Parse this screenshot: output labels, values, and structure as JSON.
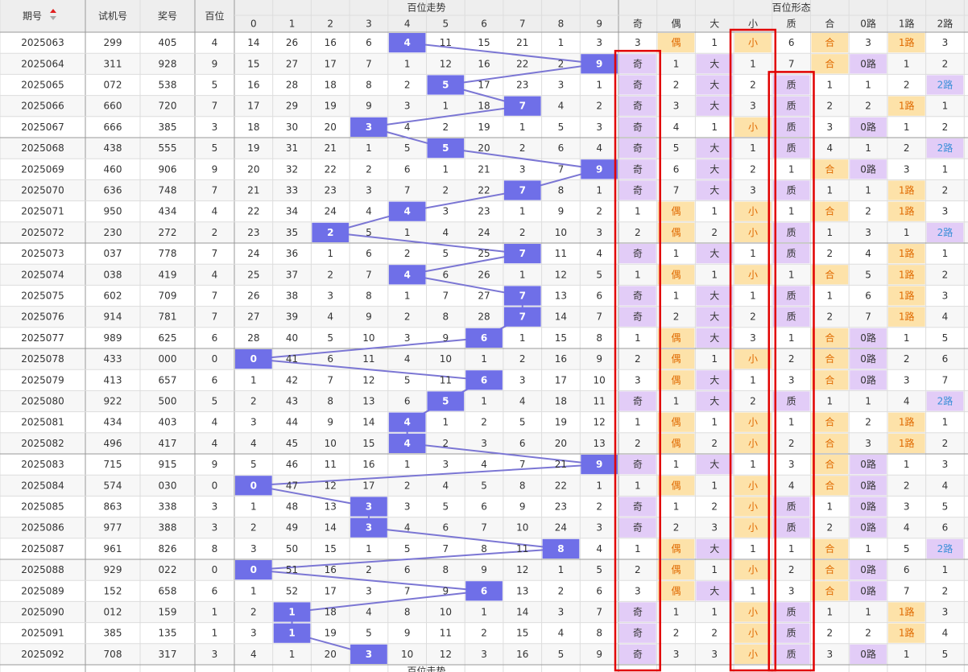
{
  "header": {
    "period_label": "期号",
    "test_label": "试机号",
    "prize_label": "奖号",
    "hundreds_label": "百位",
    "trend_label": "百位走势",
    "form_label": "百位形态",
    "trend_digits": [
      "0",
      "1",
      "2",
      "3",
      "4",
      "5",
      "6",
      "7",
      "8",
      "9"
    ],
    "form_labels": [
      "奇",
      "偶",
      "大",
      "小",
      "质",
      "合",
      "0路",
      "1路",
      "2路"
    ],
    "bottom_partial_label": "百位走势"
  },
  "colors": {
    "header_bg": "#eeeeee",
    "border": "#dddddd",
    "group_border": "#999999",
    "alt_row": "#f7f7f7",
    "blue_ball": "#6f6fe8",
    "line": "#7b76d4",
    "odd_purple": "#e2ccf7",
    "even_orange": "#fde2a9",
    "even_text": "#e06a00",
    "highlight_red": "#e10000"
  },
  "markers": {
    "odd": "奇",
    "even": "偶",
    "big": "大",
    "small": "小",
    "prime": "质",
    "composite": "合",
    "r0": "0路",
    "r1": "1路",
    "r2": "2路"
  },
  "rows": [
    {
      "issue": "2025063",
      "test": "299",
      "prize": "405",
      "h": "4",
      "t": [
        "14",
        "26",
        "16",
        "6",
        "4",
        "11",
        "15",
        "21",
        "1",
        "3"
      ],
      "f": [
        "3",
        "偶",
        "1",
        "小",
        "6",
        "合",
        "3",
        "1路",
        "3"
      ]
    },
    {
      "issue": "2025064",
      "test": "311",
      "prize": "928",
      "h": "9",
      "t": [
        "15",
        "27",
        "17",
        "7",
        "1",
        "12",
        "16",
        "22",
        "2",
        "9"
      ],
      "f": [
        "奇",
        "1",
        "大",
        "1",
        "7",
        "合",
        "0路",
        "1",
        "2"
      ]
    },
    {
      "issue": "2025065",
      "test": "072",
      "prize": "538",
      "h": "5",
      "t": [
        "16",
        "28",
        "18",
        "8",
        "2",
        "5",
        "17",
        "23",
        "3",
        "1"
      ],
      "f": [
        "奇",
        "2",
        "大",
        "2",
        "质",
        "1",
        "1",
        "2",
        "2路"
      ]
    },
    {
      "issue": "2025066",
      "test": "660",
      "prize": "720",
      "h": "7",
      "t": [
        "17",
        "29",
        "19",
        "9",
        "3",
        "1",
        "18",
        "7",
        "4",
        "2"
      ],
      "f": [
        "奇",
        "3",
        "大",
        "3",
        "质",
        "2",
        "2",
        "1路",
        "1"
      ]
    },
    {
      "issue": "2025067",
      "test": "666",
      "prize": "385",
      "h": "3",
      "t": [
        "18",
        "30",
        "20",
        "3",
        "4",
        "2",
        "19",
        "1",
        "5",
        "3"
      ],
      "f": [
        "奇",
        "4",
        "1",
        "小",
        "质",
        "3",
        "0路",
        "1",
        "2"
      ]
    },
    {
      "issue": "2025068",
      "test": "438",
      "prize": "555",
      "h": "5",
      "t": [
        "19",
        "31",
        "21",
        "1",
        "5",
        "5",
        "20",
        "2",
        "6",
        "4"
      ],
      "f": [
        "奇",
        "5",
        "大",
        "1",
        "质",
        "4",
        "1",
        "2",
        "2路"
      ]
    },
    {
      "issue": "2025069",
      "test": "460",
      "prize": "906",
      "h": "9",
      "t": [
        "20",
        "32",
        "22",
        "2",
        "6",
        "1",
        "21",
        "3",
        "7",
        "9"
      ],
      "f": [
        "奇",
        "6",
        "大",
        "2",
        "1",
        "合",
        "0路",
        "3",
        "1"
      ]
    },
    {
      "issue": "2025070",
      "test": "636",
      "prize": "748",
      "h": "7",
      "t": [
        "21",
        "33",
        "23",
        "3",
        "7",
        "2",
        "22",
        "7",
        "8",
        "1"
      ],
      "f": [
        "奇",
        "7",
        "大",
        "3",
        "质",
        "1",
        "1",
        "1路",
        "2"
      ]
    },
    {
      "issue": "2025071",
      "test": "950",
      "prize": "434",
      "h": "4",
      "t": [
        "22",
        "34",
        "24",
        "4",
        "4",
        "3",
        "23",
        "1",
        "9",
        "2"
      ],
      "f": [
        "1",
        "偶",
        "1",
        "小",
        "1",
        "合",
        "2",
        "1路",
        "3"
      ]
    },
    {
      "issue": "2025072",
      "test": "230",
      "prize": "272",
      "h": "2",
      "t": [
        "23",
        "35",
        "2",
        "5",
        "1",
        "4",
        "24",
        "2",
        "10",
        "3"
      ],
      "f": [
        "2",
        "偶",
        "2",
        "小",
        "质",
        "1",
        "3",
        "1",
        "2路"
      ]
    },
    {
      "issue": "2025073",
      "test": "037",
      "prize": "778",
      "h": "7",
      "t": [
        "24",
        "36",
        "1",
        "6",
        "2",
        "5",
        "25",
        "7",
        "11",
        "4"
      ],
      "f": [
        "奇",
        "1",
        "大",
        "1",
        "质",
        "2",
        "4",
        "1路",
        "1"
      ]
    },
    {
      "issue": "2025074",
      "test": "038",
      "prize": "419",
      "h": "4",
      "t": [
        "25",
        "37",
        "2",
        "7",
        "4",
        "6",
        "26",
        "1",
        "12",
        "5"
      ],
      "f": [
        "1",
        "偶",
        "1",
        "小",
        "1",
        "合",
        "5",
        "1路",
        "2"
      ]
    },
    {
      "issue": "2025075",
      "test": "602",
      "prize": "709",
      "h": "7",
      "t": [
        "26",
        "38",
        "3",
        "8",
        "1",
        "7",
        "27",
        "7",
        "13",
        "6"
      ],
      "f": [
        "奇",
        "1",
        "大",
        "1",
        "质",
        "1",
        "6",
        "1路",
        "3"
      ]
    },
    {
      "issue": "2025076",
      "test": "914",
      "prize": "781",
      "h": "7",
      "t": [
        "27",
        "39",
        "4",
        "9",
        "2",
        "8",
        "28",
        "7",
        "14",
        "7"
      ],
      "f": [
        "奇",
        "2",
        "大",
        "2",
        "质",
        "2",
        "7",
        "1路",
        "4"
      ]
    },
    {
      "issue": "2025077",
      "test": "989",
      "prize": "625",
      "h": "6",
      "t": [
        "28",
        "40",
        "5",
        "10",
        "3",
        "9",
        "6",
        "1",
        "15",
        "8"
      ],
      "f": [
        "1",
        "偶",
        "大",
        "3",
        "1",
        "合",
        "0路",
        "1",
        "5"
      ]
    },
    {
      "issue": "2025078",
      "test": "433",
      "prize": "000",
      "h": "0",
      "t": [
        "0",
        "41",
        "6",
        "11",
        "4",
        "10",
        "1",
        "2",
        "16",
        "9"
      ],
      "f": [
        "2",
        "偶",
        "1",
        "小",
        "2",
        "合",
        "0路",
        "2",
        "6"
      ]
    },
    {
      "issue": "2025079",
      "test": "413",
      "prize": "657",
      "h": "6",
      "t": [
        "1",
        "42",
        "7",
        "12",
        "5",
        "11",
        "6",
        "3",
        "17",
        "10"
      ],
      "f": [
        "3",
        "偶",
        "大",
        "1",
        "3",
        "合",
        "0路",
        "3",
        "7"
      ]
    },
    {
      "issue": "2025080",
      "test": "922",
      "prize": "500",
      "h": "5",
      "t": [
        "2",
        "43",
        "8",
        "13",
        "6",
        "5",
        "1",
        "4",
        "18",
        "11"
      ],
      "f": [
        "奇",
        "1",
        "大",
        "2",
        "质",
        "1",
        "1",
        "4",
        "2路"
      ]
    },
    {
      "issue": "2025081",
      "test": "434",
      "prize": "403",
      "h": "4",
      "t": [
        "3",
        "44",
        "9",
        "14",
        "4",
        "1",
        "2",
        "5",
        "19",
        "12"
      ],
      "f": [
        "1",
        "偶",
        "1",
        "小",
        "1",
        "合",
        "2",
        "1路",
        "1"
      ]
    },
    {
      "issue": "2025082",
      "test": "496",
      "prize": "417",
      "h": "4",
      "t": [
        "4",
        "45",
        "10",
        "15",
        "4",
        "2",
        "3",
        "6",
        "20",
        "13"
      ],
      "f": [
        "2",
        "偶",
        "2",
        "小",
        "2",
        "合",
        "3",
        "1路",
        "2"
      ]
    },
    {
      "issue": "2025083",
      "test": "715",
      "prize": "915",
      "h": "9",
      "t": [
        "5",
        "46",
        "11",
        "16",
        "1",
        "3",
        "4",
        "7",
        "21",
        "9"
      ],
      "f": [
        "奇",
        "1",
        "大",
        "1",
        "3",
        "合",
        "0路",
        "1",
        "3"
      ]
    },
    {
      "issue": "2025084",
      "test": "574",
      "prize": "030",
      "h": "0",
      "t": [
        "0",
        "47",
        "12",
        "17",
        "2",
        "4",
        "5",
        "8",
        "22",
        "1"
      ],
      "f": [
        "1",
        "偶",
        "1",
        "小",
        "4",
        "合",
        "0路",
        "2",
        "4"
      ]
    },
    {
      "issue": "2025085",
      "test": "863",
      "prize": "338",
      "h": "3",
      "t": [
        "1",
        "48",
        "13",
        "3",
        "3",
        "5",
        "6",
        "9",
        "23",
        "2"
      ],
      "f": [
        "奇",
        "1",
        "2",
        "小",
        "质",
        "1",
        "0路",
        "3",
        "5"
      ]
    },
    {
      "issue": "2025086",
      "test": "977",
      "prize": "388",
      "h": "3",
      "t": [
        "2",
        "49",
        "14",
        "3",
        "4",
        "6",
        "7",
        "10",
        "24",
        "3"
      ],
      "f": [
        "奇",
        "2",
        "3",
        "小",
        "质",
        "2",
        "0路",
        "4",
        "6"
      ]
    },
    {
      "issue": "2025087",
      "test": "961",
      "prize": "826",
      "h": "8",
      "t": [
        "3",
        "50",
        "15",
        "1",
        "5",
        "7",
        "8",
        "11",
        "8",
        "4"
      ],
      "f": [
        "1",
        "偶",
        "大",
        "1",
        "1",
        "合",
        "1",
        "5",
        "2路"
      ]
    },
    {
      "issue": "2025088",
      "test": "929",
      "prize": "022",
      "h": "0",
      "t": [
        "0",
        "51",
        "16",
        "2",
        "6",
        "8",
        "9",
        "12",
        "1",
        "5"
      ],
      "f": [
        "2",
        "偶",
        "1",
        "小",
        "2",
        "合",
        "0路",
        "6",
        "1"
      ]
    },
    {
      "issue": "2025089",
      "test": "152",
      "prize": "658",
      "h": "6",
      "t": [
        "1",
        "52",
        "17",
        "3",
        "7",
        "9",
        "6",
        "13",
        "2",
        "6"
      ],
      "f": [
        "3",
        "偶",
        "大",
        "1",
        "3",
        "合",
        "0路",
        "7",
        "2"
      ]
    },
    {
      "issue": "2025090",
      "test": "012",
      "prize": "159",
      "h": "1",
      "t": [
        "2",
        "1",
        "18",
        "4",
        "8",
        "10",
        "1",
        "14",
        "3",
        "7"
      ],
      "f": [
        "奇",
        "1",
        "1",
        "小",
        "质",
        "1",
        "1",
        "1路",
        "3"
      ]
    },
    {
      "issue": "2025091",
      "test": "385",
      "prize": "135",
      "h": "1",
      "t": [
        "3",
        "1",
        "19",
        "5",
        "9",
        "11",
        "2",
        "15",
        "4",
        "8"
      ],
      "f": [
        "奇",
        "2",
        "2",
        "小",
        "质",
        "2",
        "2",
        "1路",
        "4"
      ]
    },
    {
      "issue": "2025092",
      "test": "708",
      "prize": "317",
      "h": "3",
      "t": [
        "4",
        "1",
        "20",
        "3",
        "10",
        "12",
        "3",
        "16",
        "5",
        "9"
      ],
      "f": [
        "奇",
        "3",
        "3",
        "小",
        "质",
        "3",
        "0路",
        "1",
        "5"
      ]
    }
  ],
  "highlight_boxes": [
    {
      "column": "奇",
      "from_issue": "2025064",
      "to_issue": "2025092"
    },
    {
      "column": "小",
      "from_issue": "2025063",
      "to_issue": "2025092"
    },
    {
      "column": "质",
      "from_issue": "2025065",
      "to_issue": "2025092"
    }
  ]
}
